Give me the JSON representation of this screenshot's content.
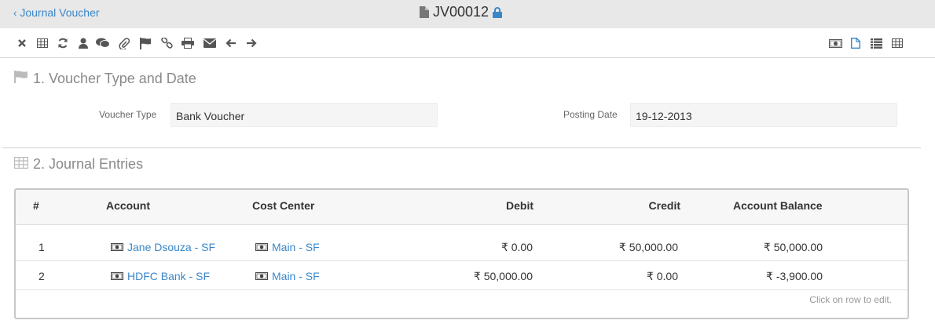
{
  "header": {
    "back_label": "Journal Voucher",
    "doc_id": "JV00012"
  },
  "toolbar": {
    "left_icons": [
      "close-icon",
      "table-icon",
      "refresh-icon",
      "user-icon",
      "comments-icon",
      "paperclip-icon",
      "flag-icon",
      "link-icon",
      "print-icon",
      "envelope-icon",
      "arrow-left-icon",
      "arrow-right-icon"
    ],
    "right_icons": [
      "money-icon",
      "file-icon",
      "list-icon",
      "table-icon"
    ]
  },
  "section1": {
    "title": "1. Voucher Type and Date",
    "voucher_type_label": "Voucher Type",
    "voucher_type_value": "Bank Voucher",
    "posting_date_label": "Posting Date",
    "posting_date_value": "19-12-2013"
  },
  "section2": {
    "title": "2. Journal Entries",
    "columns": [
      "#",
      "Account",
      "Cost Center",
      "Debit",
      "Credit",
      "Account Balance"
    ],
    "rows": [
      {
        "idx": "1",
        "account": "Jane Dsouza - SF",
        "cost_center": "Main - SF",
        "debit": "₹ 0.00",
        "credit": "₹ 50,000.00",
        "balance": "₹ 50,000.00"
      },
      {
        "idx": "2",
        "account": "HDFC Bank - SF",
        "cost_center": "Main - SF",
        "debit": "₹ 50,000.00",
        "credit": "₹ 0.00",
        "balance": "₹ -3,900.00"
      }
    ],
    "hint": "Click on row to edit."
  },
  "colors": {
    "link": "#3a87c8",
    "topbar_bg": "#e8e8e8",
    "section_title": "#8a8a8a"
  }
}
